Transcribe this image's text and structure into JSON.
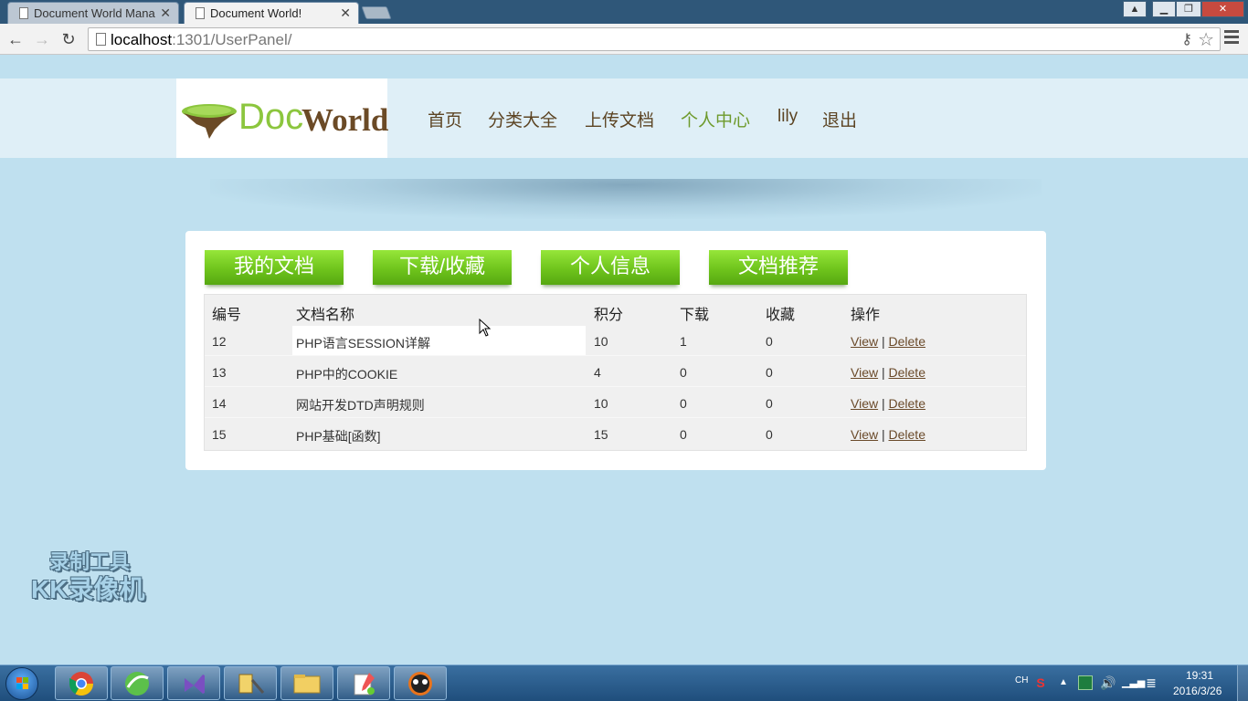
{
  "browser": {
    "tabs": [
      {
        "title": "Document World Mana ",
        "active": false
      },
      {
        "title": "Document World!",
        "active": true
      }
    ],
    "url_host": "localhost",
    "url_rest": ":1301/UserPanel/",
    "icons": {
      "back": "back-arrow-icon",
      "forward": "forward-arrow-icon",
      "reload": "reload-icon",
      "key": "key-icon",
      "star": "bookmark-star-icon",
      "menu": "menu-icon"
    },
    "window_controls": [
      "minimize",
      "maximize",
      "close"
    ]
  },
  "site": {
    "logo": {
      "doc": "Doc",
      "world": "World"
    },
    "nav": [
      "首页",
      "分类大全",
      "上传文档",
      "个人中心",
      "lily",
      "退出"
    ],
    "panel_tabs": [
      "我的文档",
      "下载/收藏",
      "个人信息",
      "文档推荐"
    ],
    "table": {
      "headers": [
        "编号",
        "文档名称",
        "积分",
        "下载",
        "收藏",
        "操作"
      ],
      "rows": [
        {
          "id": "12",
          "name": "PHP语言SESSION详解",
          "points": "10",
          "downloads": "1",
          "favorites": "0"
        },
        {
          "id": "13",
          "name": "PHP中的COOKIE",
          "points": "4",
          "downloads": "0",
          "favorites": "0"
        },
        {
          "id": "14",
          "name": "网站开发DTD声明规则",
          "points": "10",
          "downloads": "0",
          "favorites": "0"
        },
        {
          "id": "15",
          "name": "PHP基础[函数]",
          "points": "15",
          "downloads": "0",
          "favorites": "0"
        }
      ],
      "view_label": "View",
      "delete_label": "Delete",
      "separator": "|"
    }
  },
  "watermark": {
    "line1": "录制工具",
    "line2": "KK录像机"
  },
  "taskbar": {
    "lang": "CH",
    "time": "19:31",
    "date": "2016/3/26",
    "apps": [
      "chrome-icon",
      "ie-like-icon",
      "visual-studio-icon",
      "tools-icon",
      "explorer-folder-icon",
      "notepad-icon",
      "recorder-icon"
    ]
  },
  "colors": {
    "page_bg": "#bfe0ef",
    "header_bg": "#dfeff7",
    "green_button": "#6fc41c",
    "nav_brown": "#5c4423",
    "nav_green": "#6e9a2c",
    "link": "#6a4a2a"
  }
}
